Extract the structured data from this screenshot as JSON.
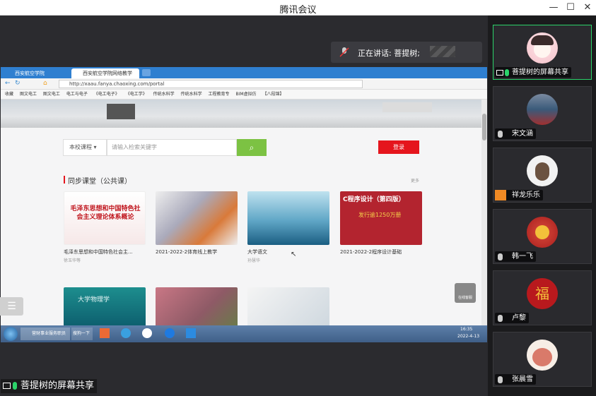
{
  "window": {
    "title": "腾讯会议"
  },
  "speaking": {
    "label": "正在讲话: 菩提树;"
  },
  "browser": {
    "tabs": [
      {
        "label": "西安航空学院"
      },
      {
        "label": "西安航空学院网络教学"
      }
    ],
    "address": "http://xaau.fanya.chaoxing.com/portal",
    "bookmarks": [
      "收藏",
      "图文电工",
      "图文电工",
      "电工与电子",
      "《电工电子》",
      "《电工学》",
      "传统水科学",
      "传统水科学",
      "工程教育专",
      "BIM虚拟仿",
      "【八段锦】"
    ]
  },
  "portal": {
    "search_scope": "本校课程",
    "search_placeholder": "请输入检索关键字",
    "login_label": "登录",
    "section_title": "同步课堂（公共课）",
    "more_label": "更多",
    "cards": [
      {
        "title": "毛泽东思想和中国特色社会主...",
        "sub": "徐玉华等",
        "cover_text": "毛泽东思想和中国特色社会主义理论体系概论"
      },
      {
        "title": "2021-2022-2体育线上教学",
        "sub": ""
      },
      {
        "title": "大学语文",
        "sub": "孙慧华"
      },
      {
        "title": "2021-2022-2程序设计基础",
        "sub": "",
        "cover_text": "C程序设计（第四版）",
        "cover_sub": "发行逾1250万册"
      },
      {
        "title": "",
        "sub": "",
        "cover_text": "大学物理学"
      },
      {
        "title": "",
        "sub": ""
      },
      {
        "title": "",
        "sub": ""
      }
    ],
    "help_label": "在线客服"
  },
  "taskbar": {
    "items": [
      "营财事业服务职员",
      "搜狗一下"
    ],
    "time": "16:35",
    "date": "2022-4-13"
  },
  "participants": [
    {
      "name": "菩提树的屏幕共享",
      "active": true,
      "avatar": "girl-avatar"
    },
    {
      "name": "宋文涵",
      "avatar": "photo-avatar"
    },
    {
      "name": "祥龙乐乐",
      "avatar": "cartoon-avatar"
    },
    {
      "name": "韩一飞",
      "avatar": "lion-avatar"
    },
    {
      "name": "卢黎",
      "avatar": "fu-avatar",
      "fu": "福"
    },
    {
      "name": "张晨雪",
      "avatar": "bear-avatar"
    }
  ],
  "bottom_label": "菩提树的屏幕共享",
  "colors": {
    "accent_green": "#2bd36a",
    "login_red": "#e5151d",
    "search_green": "#7cc243",
    "section_red": "#e5151d"
  }
}
